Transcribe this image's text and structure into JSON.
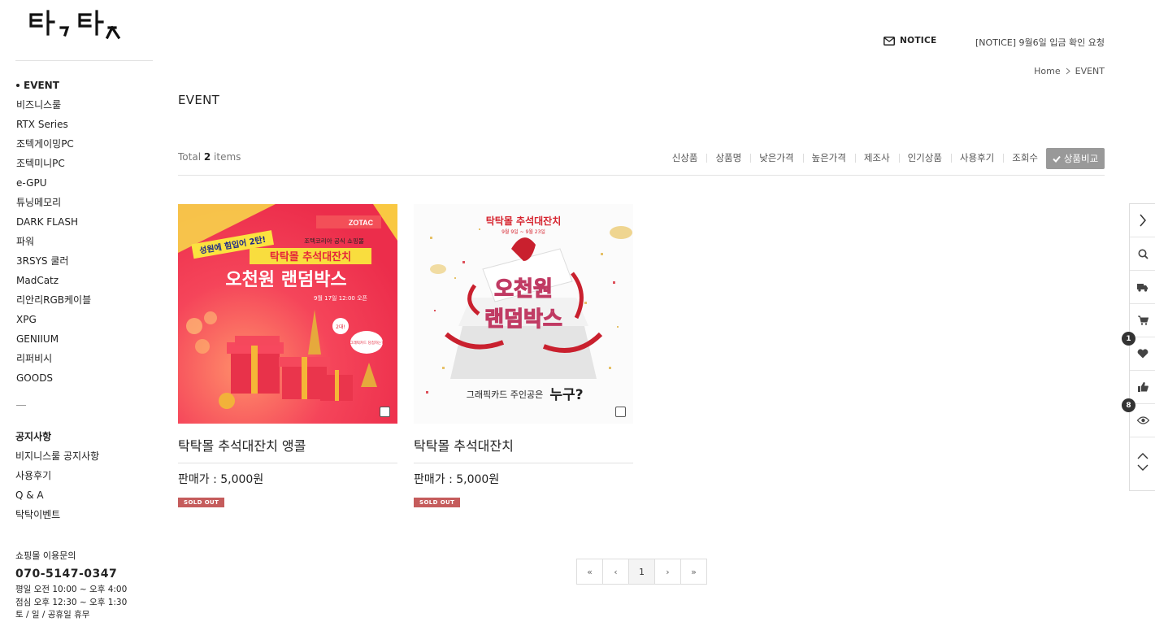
{
  "header": {
    "notice_label": "NOTICE",
    "notice_text": "[NOTICE] 9월6일 입금 확인 요청",
    "breadcrumb": {
      "home": "Home",
      "current": "EVENT"
    }
  },
  "sidebar": {
    "categories": [
      {
        "label": "EVENT",
        "active": true
      },
      {
        "label": "비즈니스룰"
      },
      {
        "label": "RTX Series"
      },
      {
        "label": "조텍게이밍PC"
      },
      {
        "label": "조텍미니PC"
      },
      {
        "label": "e-GPU"
      },
      {
        "label": "튜닝메모리"
      },
      {
        "label": "DARK FLASH"
      },
      {
        "label": "파워"
      },
      {
        "label": "3RSYS 쿨러"
      },
      {
        "label": "MadCatz"
      },
      {
        "label": "리안리RGB케이블"
      },
      {
        "label": "XPG"
      },
      {
        "label": "GENIIUM"
      },
      {
        "label": "리퍼비시"
      },
      {
        "label": "GOODS"
      }
    ],
    "board_title": "공지사항",
    "boards": [
      "비지니스룰 공지사항",
      "사용후기",
      "Q & A",
      "탁탁이벤트"
    ],
    "cs": {
      "label": "쇼핑몰 이용문의",
      "phone": "070-5147-0347",
      "hours": [
        "평일 오전 10:00 ~ 오후 4:00",
        "점심 오후 12:30 ~ 오후 1:30",
        "토 / 일 / 공휴일 휴무"
      ]
    }
  },
  "main": {
    "title": "EVENT",
    "total_prefix": "Total",
    "total_count": "2",
    "total_suffix": "items",
    "sort_options": [
      "신상품",
      "상품명",
      "낮은가격",
      "높은가격",
      "제조사",
      "인기상품",
      "사용후기",
      "조회수"
    ],
    "compare_label": "상품비교",
    "products": [
      {
        "name": "탁탁몰 추석대잔치 앵콜",
        "price": "판매가 : 5,000원",
        "sold_out": "SOLD OUT",
        "banner": {
          "brand": "ZOTAC",
          "ribbon": "성원에 힘입어 2탄!",
          "sub": "조텍코리아 공식 쇼핑몰",
          "line1": "탁탁몰 추석대잔치",
          "line2": "오천원 랜덤박스",
          "date": "9월 17일 12:00 오픈",
          "bubble1": "2대!",
          "bubble2": "그래픽카드 당첨자는?"
        }
      },
      {
        "name": "탁탁몰 추석대잔치",
        "price": "판매가 : 5,000원",
        "sold_out": "SOLD OUT",
        "banner": {
          "line1": "탁탁몰 추석대잔치",
          "date": "9월 9일 ~ 9월 23일",
          "big1": "오천원",
          "big2": "랜덤박스",
          "bottom_a": "그래픽카드 주인공은",
          "bottom_b": "누구?"
        }
      }
    ],
    "pagination": {
      "first": "«",
      "prev": "‹",
      "current": "1",
      "next": "›",
      "last": "»"
    }
  },
  "quickbar": {
    "wishlist_count": "1",
    "recent_count": "8"
  },
  "colors": {
    "sold_out": "#c55c5c",
    "banner_red": "#f2394f",
    "compare_btn": "#999999"
  }
}
